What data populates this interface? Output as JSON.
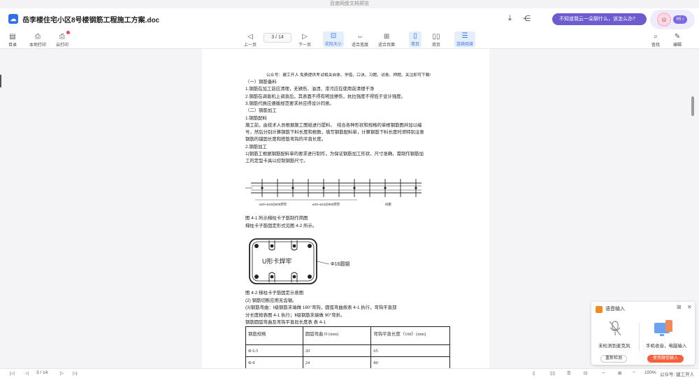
{
  "window": {
    "title": "百度网盘文档预览"
  },
  "header": {
    "doc_title": "岳李楼住宅小区8号楼钢筋工程施工方案.doc",
    "ai_prompt": "不知道我云一朵聊什么，该怎么办?",
    "ai_hi": "Hi ›"
  },
  "toolbar": {
    "toc": "目录",
    "local_print": "本地打印",
    "cloud_print": "云打印",
    "prev_page": "上一页",
    "page_indicator": "3 / 14",
    "next_page": "下一页",
    "actual_size": "实际大小",
    "fit_width": "适合宽度",
    "fit_page": "适合页面",
    "single_page": "单页",
    "double_page": "双页",
    "continuous": "连续阅读",
    "search": "查找",
    "edit": "编辑"
  },
  "document": {
    "note": "公众号：建工开人  免费提供考试相关自体、学借、口诀、习题、试卷、押题、关注即可下载!",
    "lines": [
      "（一）钢筋备料",
      "1.钢筋在加工前应清理，无锈伤、油渍、漆污应在使用前清理干净",
      "2.钢筋在调直机上调直后，其表面不得有明显擦伤，抗拉强度不得低于设计强度。",
      "3.钢筋代换应遵循规范要求并应得设计同意。",
      "（二）钢筋加工",
      "1.钢筋配料",
      "施工前，由技术人员根据施工图纸进行提料，　结合各种形状和规格的单根钢筋图并加以编",
      "号，然后分别计算钢筋下料长度和根数，填写钢筋配料单，计算钢筋下料长度时须特别注意",
      "钢筋的锚固长度和搭筋弯钩的平直长度。",
      "2.钢筋加工",
      "1)钢筋工根据钢筋配料单的要求进行制作，为保证钢筋加工形状、尺寸准确，需制作钢筋加",
      "工的定型卡具以控制钢筋尺寸。"
    ],
    "fig1_caption": "图 4-1  所示梯柱卡子筋制作简图",
    "fig1_subcaption": "梯柱卡子筋固定形式见图 4-2  所示。",
    "fig1_labels": {
      "left": "ø10~ø12@500焊牢",
      "mid": "ø10~ø12@500焊牢",
      "end": "间距"
    },
    "fig2_label_center": "U形卡焊牢",
    "fig2_label_right": "Φ16圆钢",
    "fig2_caption": "图 4-2  梯柱卡子筋固定示意图",
    "lines_after": [
      "(2) 钢筋切断应用无齿锯。",
      "(3)钢筋弯曲：Ⅰ级钢筋末端做 180°弯钩，圆弧弯曲按表 4-1 执行，弯钩平直部",
      "分长度按表图 4-1 执行；Ⅱ级钢筋末端做 90°弯折。",
      "钢筋圆弧弯曲及弯钩平直段长度表  表 4-1"
    ],
    "table": {
      "headers": [
        "钢筋规格",
        "圆弧弯曲 D (mm)",
        "弯钩平直长度（10d）(mm)"
      ],
      "rows": [
        [
          "Φ 6.5",
          "20",
          "65"
        ],
        [
          "Φ 8",
          "24",
          "80"
        ]
      ]
    }
  },
  "status": {
    "page_indicator": "3 / 14",
    "zoom": "100%",
    "watermark": "公众号: 建工开人"
  },
  "ime": {
    "title": "语音输入",
    "left_label": "未检测到麦克风",
    "right_label": "手机收音，电脑输入",
    "left_button": "重新检测",
    "right_button": "使用微信输入"
  }
}
